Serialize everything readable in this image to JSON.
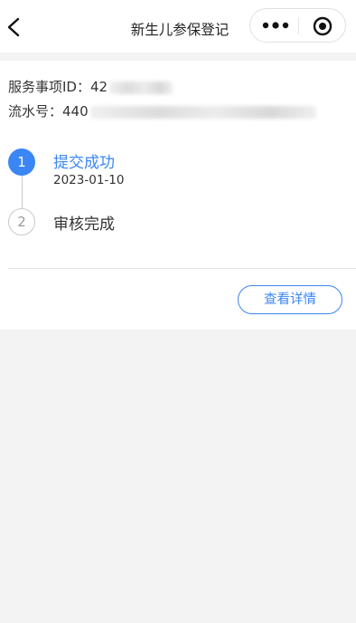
{
  "navbar": {
    "title": "新生儿参保登记",
    "back_icon": "chevron-left-icon",
    "more_icon": "more-dots-icon",
    "close_icon": "target-close-icon"
  },
  "record": {
    "service_id_label": "服务事项ID：",
    "service_id_visible": "42",
    "serial_label": "流水号：",
    "serial_visible": "440"
  },
  "steps": [
    {
      "number": "1",
      "label": "提交成功",
      "date": "2023-01-10",
      "status": "active"
    },
    {
      "number": "2",
      "label": "审核完成",
      "status": "pending"
    }
  ],
  "actions": {
    "detail_label": "查看详情"
  },
  "colors": {
    "accent": "#3a86f4",
    "background": "#f3f3f3",
    "pending": "#c9c9c9"
  }
}
